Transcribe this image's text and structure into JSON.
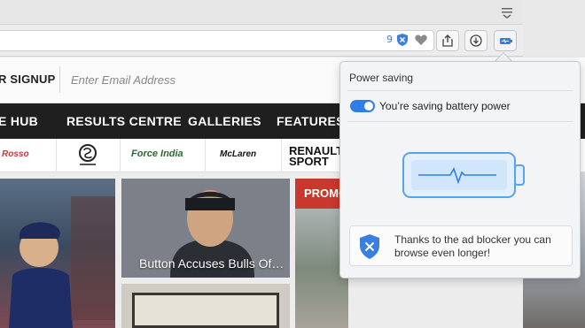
{
  "browser": {
    "menu_icon": "menu-lines-icon",
    "blocked_count": "9",
    "icons": {
      "blocker": "shield-icon",
      "favorite": "heart-icon",
      "share": "share-icon",
      "download": "download-icon",
      "power": "battery-icon"
    }
  },
  "page": {
    "signup_label": "R SIGNUP",
    "email_placeholder": "Enter Email Address",
    "nav": [
      "E HUB",
      "RESULTS CENTRE",
      "GALLERIES",
      "FEATURES"
    ],
    "logos": [
      "Rosso",
      "Sauber",
      "Force India",
      "McLaren",
      "RENAULT SPORT"
    ],
    "tile_caption": "Button Accuses Bulls Of…",
    "promo_label": "PROMO"
  },
  "popup": {
    "title": "Power saving",
    "toggle_label": "You’re saving battery power",
    "toggle_on": true,
    "info_text": "Thanks to the ad blocker you can browse even longer!",
    "accent_color": "#2f7de6"
  }
}
